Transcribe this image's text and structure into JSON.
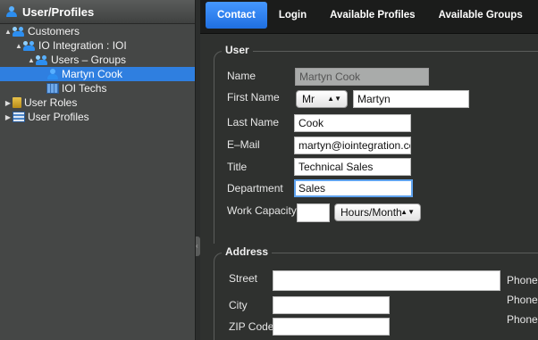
{
  "left_panel": {
    "header": "User/Profiles",
    "tree": [
      {
        "label": "Customers",
        "level": 0,
        "toggle": "▲"
      },
      {
        "label": "IO Integration : IOI",
        "level": 1,
        "toggle": "▲"
      },
      {
        "label": "Users – Groups",
        "level": 2,
        "toggle": "▲"
      },
      {
        "label": "Martyn Cook",
        "level": 3,
        "toggle": "",
        "selected": true
      },
      {
        "label": "IOI Techs",
        "level": 3,
        "toggle": ""
      },
      {
        "label": "User Roles",
        "level": 0,
        "toggle": "▶"
      },
      {
        "label": "User Profiles",
        "level": 0,
        "toggle": "▶"
      }
    ]
  },
  "tabs": [
    "Contact",
    "Login",
    "Available Profiles",
    "Available Groups"
  ],
  "active_tab": "Contact",
  "user": {
    "legend": "User",
    "name_label": "Name",
    "name_value": "Martyn Cook",
    "first_name_label": "First Name",
    "salutation": "Mr",
    "first_name_value": "Martyn",
    "last_name_label": "Last Name",
    "last_name_value": "Cook",
    "email_label": "E–Mail",
    "email_value": "martyn@iointegration.co",
    "title_label": "Title",
    "title_value": "Technical Sales",
    "department_label": "Department",
    "department_value": "Sales",
    "capacity_label": "Work Capacity",
    "capacity_value": "",
    "capacity_unit": "Hours/Month"
  },
  "address": {
    "legend": "Address",
    "street_label": "Street",
    "city_label": "City",
    "zip_label": "ZIP Code",
    "phone_label": "Phone",
    "street_value": "",
    "city_value": "",
    "zip_value": ""
  },
  "colors": {
    "selection": "#2f7fe0",
    "active_tab": "#2f86f5",
    "panel_bg": "#454746",
    "content_bg": "#2f312f"
  }
}
